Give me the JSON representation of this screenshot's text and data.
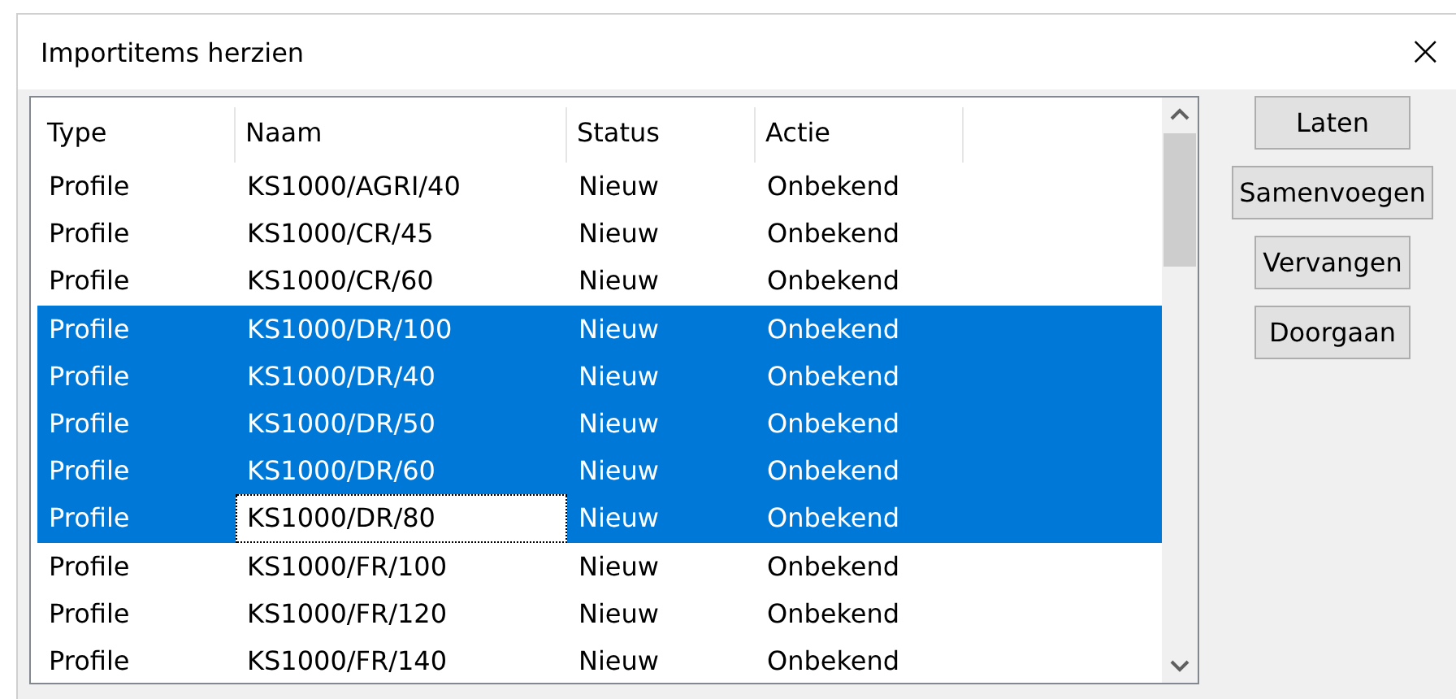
{
  "window": {
    "title": "Importitems herzien",
    "close": "×"
  },
  "table": {
    "columns": [
      "Type",
      "Naam",
      "Status",
      "Actie"
    ],
    "rows": [
      {
        "cells": [
          "Profile",
          "KS1000/AGRI/40",
          "Nieuw",
          "Onbekend"
        ],
        "selected": false,
        "focused": false
      },
      {
        "cells": [
          "Profile",
          "KS1000/CR/45",
          "Nieuw",
          "Onbekend"
        ],
        "selected": false,
        "focused": false
      },
      {
        "cells": [
          "Profile",
          "KS1000/CR/60",
          "Nieuw",
          "Onbekend"
        ],
        "selected": false,
        "focused": false
      },
      {
        "cells": [
          "Profile",
          "KS1000/DR/100",
          "Nieuw",
          "Onbekend"
        ],
        "selected": true,
        "focused": false
      },
      {
        "cells": [
          "Profile",
          "KS1000/DR/40",
          "Nieuw",
          "Onbekend"
        ],
        "selected": true,
        "focused": false
      },
      {
        "cells": [
          "Profile",
          "KS1000/DR/50",
          "Nieuw",
          "Onbekend"
        ],
        "selected": true,
        "focused": false
      },
      {
        "cells": [
          "Profile",
          "KS1000/DR/60",
          "Nieuw",
          "Onbekend"
        ],
        "selected": true,
        "focused": false
      },
      {
        "cells": [
          "Profile",
          "KS1000/DR/80",
          "Nieuw",
          "Onbekend"
        ],
        "selected": true,
        "focused": true
      },
      {
        "cells": [
          "Profile",
          "KS1000/FR/100",
          "Nieuw",
          "Onbekend"
        ],
        "selected": false,
        "focused": false
      },
      {
        "cells": [
          "Profile",
          "KS1000/FR/120",
          "Nieuw",
          "Onbekend"
        ],
        "selected": false,
        "focused": false
      },
      {
        "cells": [
          "Profile",
          "KS1000/FR/140",
          "Nieuw",
          "Onbekend"
        ],
        "selected": false,
        "focused": false
      }
    ]
  },
  "buttons": [
    "Laten",
    "Samenvoegen",
    "Vervangen",
    "Doorgaan"
  ]
}
